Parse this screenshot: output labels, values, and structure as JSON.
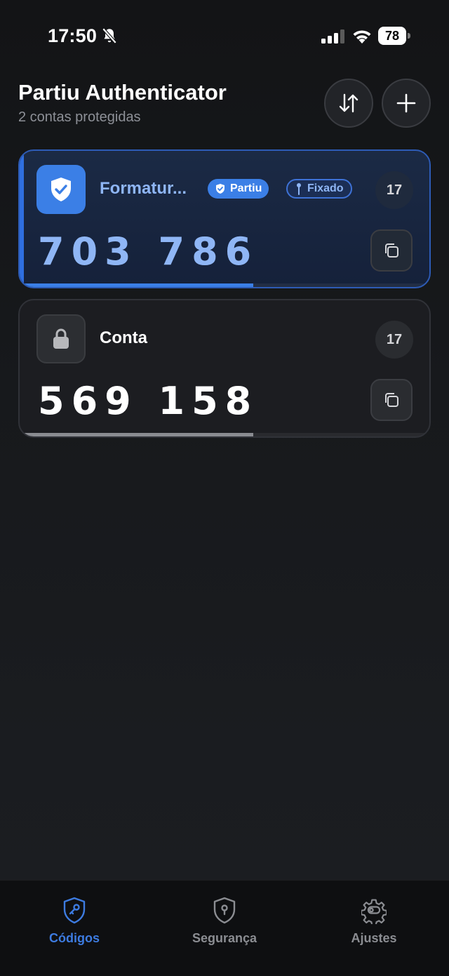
{
  "status_bar": {
    "time": "17:50",
    "battery": "78"
  },
  "header": {
    "title": "Partiu Authenticator",
    "subtitle": "2 contas protegidas"
  },
  "accounts": [
    {
      "name": "Formatur...",
      "badges": [
        "Partiu",
        "Fixado"
      ],
      "timer": "17",
      "code": "703 786",
      "progress": 0.57
    },
    {
      "name": "Conta",
      "badges": [],
      "timer": "17",
      "code": "569 158",
      "progress": 0.57
    }
  ],
  "tabs": [
    {
      "label": "Códigos",
      "active": true
    },
    {
      "label": "Segurança",
      "active": false
    },
    {
      "label": "Ajustes",
      "active": false
    }
  ],
  "colors": {
    "accent": "#3b7fe6",
    "code_active": "#8fb6f5",
    "background": "#1a1c20"
  }
}
